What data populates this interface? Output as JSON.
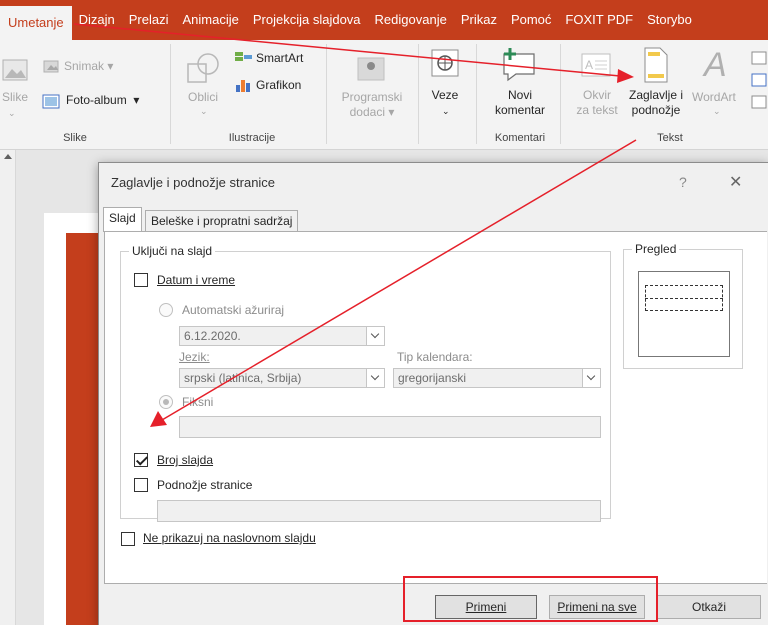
{
  "tabs": [
    "Umetanje",
    "Dizajn",
    "Prelazi",
    "Animacije",
    "Projekcija slajdova",
    "Redigovanje",
    "Prikaz",
    "Pomoć",
    "FOXIT PDF",
    "Storybo"
  ],
  "ribbon": {
    "slike_label": "Slike",
    "snimak": "Snimak",
    "foto_album": "Foto-album",
    "group_slike": "Slike",
    "oblici": "Oblici",
    "smartart": "SmartArt",
    "grafikon": "Grafikon",
    "group_ilustracije": "Ilustracije",
    "programski_l1": "Programski",
    "programski_l2": "dodaci",
    "veze": "Veze",
    "novi_l1": "Novi",
    "novi_l2": "komentar",
    "group_komentari": "Komentari",
    "okvir_l1": "Okvir",
    "okvir_l2": "za tekst",
    "zaglavlje_l1": "Zaglavlje i",
    "zaglavlje_l2": "podnožje",
    "wordart": "WordArt",
    "group_tekst": "Tekst"
  },
  "dialog": {
    "title": "Zaglavlje i podnožje stranice",
    "help": "?",
    "close": "✕",
    "tab_slajd": "Slajd",
    "tab_beleske": "Beleške i propratni sadržaj",
    "group_ukljuci": "Uključi na slajd",
    "datum": "Datum i vreme",
    "auto": "Automatski ažuriraj",
    "date_value": "6.12.2020.",
    "jezik_label": "Jezik:",
    "jezik_value": "srpski (latinica, Srbija)",
    "tip_label": "Tip kalendara:",
    "tip_value": "gregorijanski",
    "fiksni": "Fiksni",
    "broj_slajda": "Broj slajda",
    "podnozje": "Podnožje stranice",
    "ne_prikazuj": "Ne prikazuj na naslovnom slajdu",
    "pregled": "Pregled",
    "btn_primeni": "Primeni",
    "btn_primeni_sve": "Primeni na sve",
    "btn_otkazi": "Otkaži"
  },
  "colors": {
    "accent": "#c43e1c",
    "annotation": "#e5202a"
  }
}
